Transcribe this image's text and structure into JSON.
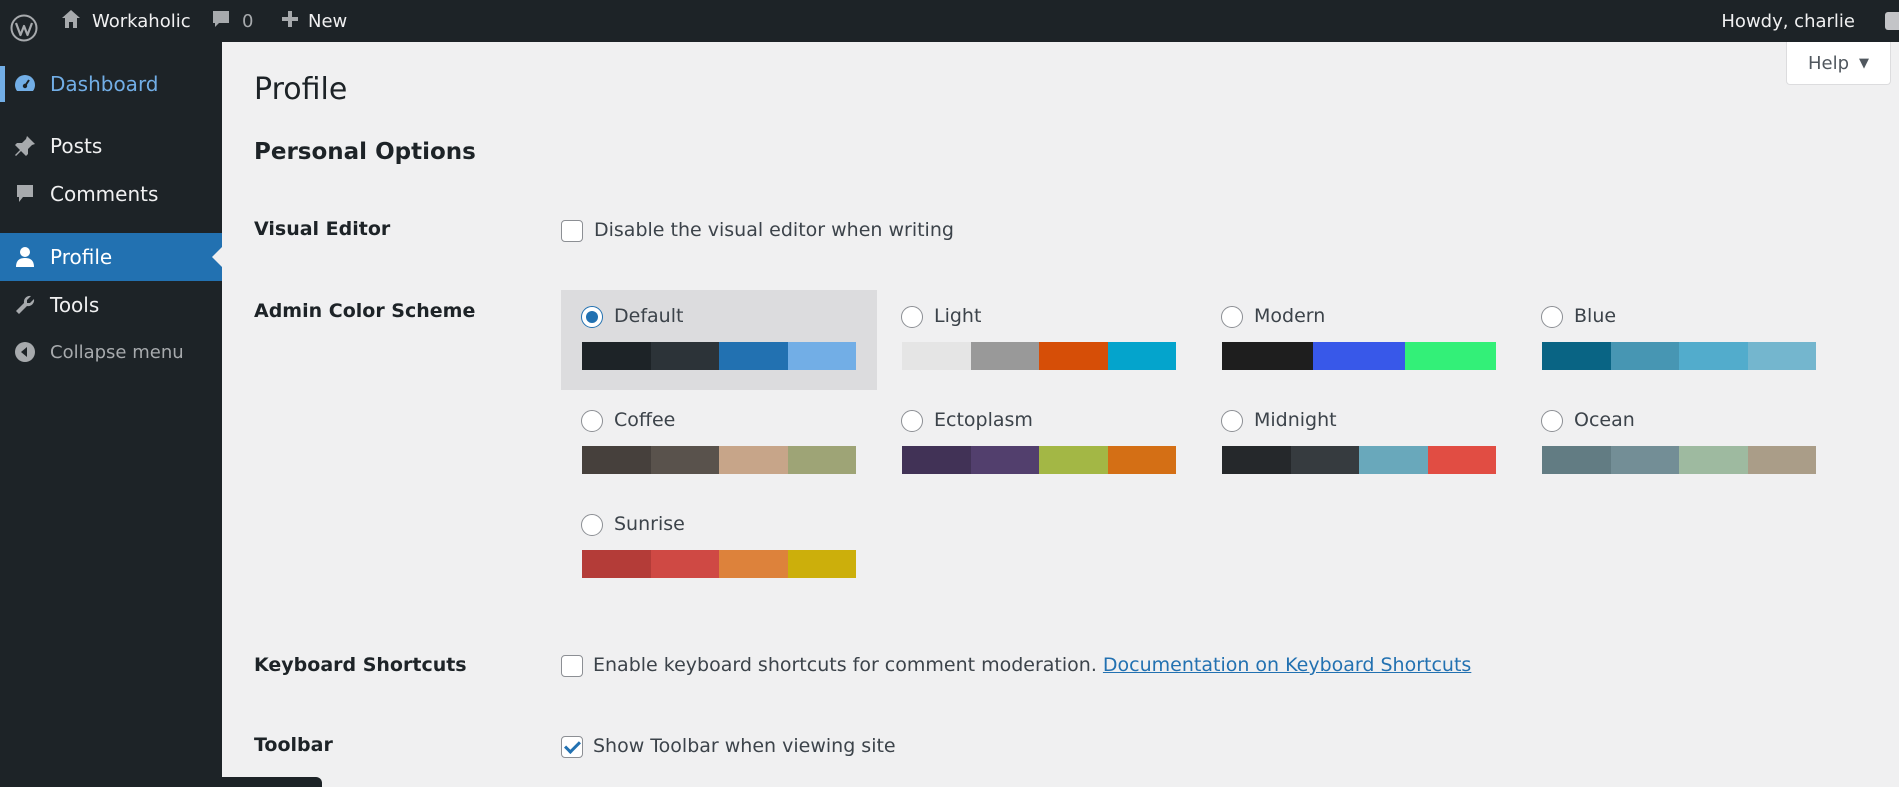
{
  "adminbar": {
    "site_name": "Workaholic",
    "comments_count": "0",
    "new_label": "New",
    "howdy": "Howdy, charlie"
  },
  "sidebar": {
    "items": [
      {
        "label": "Dashboard",
        "icon": "dashboard-icon"
      },
      {
        "label": "Posts",
        "icon": "pin-icon"
      },
      {
        "label": "Comments",
        "icon": "comment-icon"
      },
      {
        "label": "Profile",
        "icon": "user-icon"
      },
      {
        "label": "Tools",
        "icon": "wrench-icon"
      },
      {
        "label": "Collapse menu",
        "icon": "collapse-arrow-icon"
      }
    ]
  },
  "help": {
    "label": "Help"
  },
  "page": {
    "title": "Profile",
    "section_title": "Personal Options",
    "visual_editor": {
      "label": "Visual Editor",
      "text": "Disable the visual editor when writing",
      "checked": false
    },
    "color_scheme": {
      "label": "Admin Color Scheme",
      "selected": "Default",
      "schemes": [
        {
          "name": "Default",
          "colors": [
            "#1d2327",
            "#2c3338",
            "#2271b1",
            "#72aee6"
          ]
        },
        {
          "name": "Light",
          "colors": [
            "#e5e5e5",
            "#999999",
            "#d64e07",
            "#04a4cc"
          ]
        },
        {
          "name": "Modern",
          "colors": [
            "#1e1e1e",
            "#3858e9",
            "#33f078"
          ]
        },
        {
          "name": "Blue",
          "colors": [
            "#096484",
            "#4796b3",
            "#52accc",
            "#74b6ce"
          ]
        },
        {
          "name": "Coffee",
          "colors": [
            "#46403c",
            "#59524c",
            "#c7a589",
            "#9ea476"
          ]
        },
        {
          "name": "Ectoplasm",
          "colors": [
            "#413256",
            "#523f6d",
            "#a3b745",
            "#d46f15"
          ]
        },
        {
          "name": "Midnight",
          "colors": [
            "#25282b",
            "#363b3f",
            "#69a8bb",
            "#e14d43"
          ]
        },
        {
          "name": "Ocean",
          "colors": [
            "#627c83",
            "#738e96",
            "#9ebaa0",
            "#aa9d88"
          ]
        },
        {
          "name": "Sunrise",
          "colors": [
            "#b43c38",
            "#cf4944",
            "#dd823b",
            "#ccaf0b"
          ]
        }
      ]
    },
    "keyboard": {
      "label": "Keyboard Shortcuts",
      "text": "Enable keyboard shortcuts for comment moderation.",
      "link": "Documentation on Keyboard Shortcuts",
      "checked": false
    },
    "toolbar": {
      "label": "Toolbar",
      "text": "Show Toolbar when viewing site",
      "checked": true
    }
  }
}
